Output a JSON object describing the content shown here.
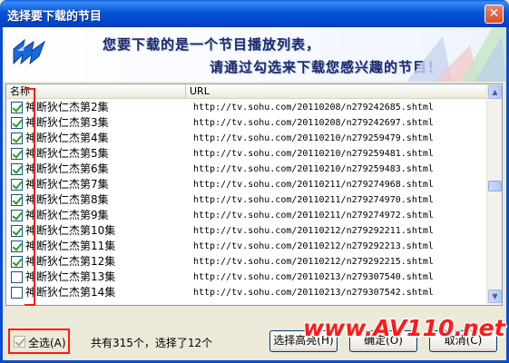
{
  "window": {
    "title": "选择要下载的节目",
    "close_icon": "close-icon"
  },
  "banner": {
    "line1": "您要下载的是一个节目播放列表，",
    "line2": "请通过勾选来下载您感兴趣的节目！",
    "logo_icon": "flash-logo-icon"
  },
  "list": {
    "columns": {
      "name": "名称",
      "url": "URL"
    },
    "rows": [
      {
        "name": "神断狄仁杰第2集",
        "url": "http://tv.sohu.com/20110208/n279242685.shtml",
        "checked": true
      },
      {
        "name": "神断狄仁杰第3集",
        "url": "http://tv.sohu.com/20110208/n279242697.shtml",
        "checked": true
      },
      {
        "name": "神断狄仁杰第4集",
        "url": "http://tv.sohu.com/20110210/n279259479.shtml",
        "checked": true
      },
      {
        "name": "神断狄仁杰第5集",
        "url": "http://tv.sohu.com/20110210/n279259481.shtml",
        "checked": true
      },
      {
        "name": "神断狄仁杰第6集",
        "url": "http://tv.sohu.com/20110210/n279259483.shtml",
        "checked": true
      },
      {
        "name": "神断狄仁杰第7集",
        "url": "http://tv.sohu.com/20110211/n279274968.shtml",
        "checked": true
      },
      {
        "name": "神断狄仁杰第8集",
        "url": "http://tv.sohu.com/20110211/n279274970.shtml",
        "checked": true
      },
      {
        "name": "神断狄仁杰第9集",
        "url": "http://tv.sohu.com/20110211/n279274972.shtml",
        "checked": true
      },
      {
        "name": "神断狄仁杰第10集",
        "url": "http://tv.sohu.com/20110212/n279292211.shtml",
        "checked": true
      },
      {
        "name": "神断狄仁杰第11集",
        "url": "http://tv.sohu.com/20110212/n279292213.shtml",
        "checked": true
      },
      {
        "name": "神断狄仁杰第12集",
        "url": "http://tv.sohu.com/20110212/n279292215.shtml",
        "checked": true
      },
      {
        "name": "神断狄仁杰第13集",
        "url": "http://tv.sohu.com/20110213/n279307540.shtml",
        "checked": false
      },
      {
        "name": "神断狄仁杰第14集",
        "url": "http://tv.sohu.com/20110213/n279307542.shtml",
        "checked": false
      }
    ]
  },
  "bottom": {
    "select_all": "全选(A)",
    "select_all_checked": true,
    "status": "共有315个，选择了12个",
    "highlight_button": "选择高亮(H)",
    "ok_button": "确定(O)",
    "cancel_button": "取消(C)"
  },
  "watermark": "www.AV110.net",
  "colors": {
    "title_bar": "#0756d6",
    "highlight_red": "#ff1a1a",
    "check_green": "#21a121"
  }
}
